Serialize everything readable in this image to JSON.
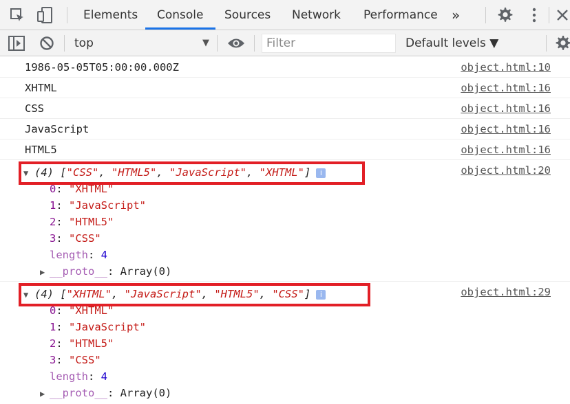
{
  "tabs": {
    "items": [
      "Elements",
      "Console",
      "Sources",
      "Network",
      "Performance"
    ],
    "active": "Console",
    "more": "»"
  },
  "toolbar": {
    "context": "top",
    "filter_placeholder": "Filter",
    "levels": "Default levels ▼"
  },
  "messages": [
    {
      "text": "1986-05-05T05:00:00.000Z",
      "source": "object.html:10"
    },
    {
      "text": "XHTML",
      "source": "object.html:16"
    },
    {
      "text": "CSS",
      "source": "object.html:16"
    },
    {
      "text": "JavaScript",
      "source": "object.html:16"
    },
    {
      "text": "HTML5",
      "source": "object.html:16"
    }
  ],
  "arrays": [
    {
      "source": "object.html:20",
      "count": "(4)",
      "preview": [
        "\"CSS\"",
        "\"HTML5\"",
        "\"JavaScript\"",
        "\"XHTML\""
      ],
      "items": [
        {
          "key": "0",
          "value": "\"XHTML\""
        },
        {
          "key": "1",
          "value": "\"JavaScript\""
        },
        {
          "key": "2",
          "value": "\"HTML5\""
        },
        {
          "key": "3",
          "value": "\"CSS\""
        }
      ],
      "length_key": "length",
      "length_value": "4",
      "proto_key": "__proto__",
      "proto_value": "Array(0)"
    },
    {
      "source": "object.html:29",
      "count": "(4)",
      "preview": [
        "\"XHTML\"",
        "\"JavaScript\"",
        "\"HTML5\"",
        "\"CSS\""
      ],
      "items": [
        {
          "key": "0",
          "value": "\"XHTML\""
        },
        {
          "key": "1",
          "value": "\"JavaScript\""
        },
        {
          "key": "2",
          "value": "\"HTML5\""
        },
        {
          "key": "3",
          "value": "\"CSS\""
        }
      ],
      "length_key": "length",
      "length_value": "4",
      "proto_key": "__proto__",
      "proto_value": "Array(0)"
    }
  ],
  "colors": {
    "accent": "#1a73e8",
    "highlight": "#e21f26",
    "string": "#c41a16",
    "number": "#1c00cf",
    "key": "#881391"
  }
}
